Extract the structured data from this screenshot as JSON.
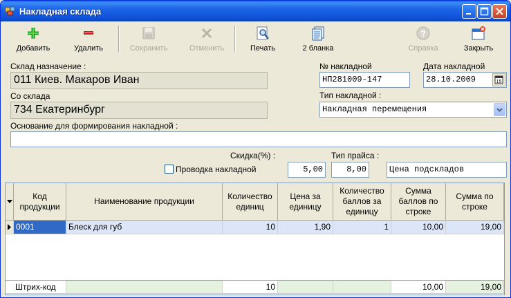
{
  "window": {
    "title": "Накладная склада"
  },
  "toolbar": {
    "add": "Добавить",
    "delete": "Удалить",
    "save": "Сохранить",
    "cancel": "Отменить",
    "print": "Печать",
    "two_forms": "2 бланка",
    "help": "Справка",
    "close": "Закрыть"
  },
  "form": {
    "dest_warehouse_label": "Склад назначение :",
    "dest_warehouse_value": "011 Киев. Макаров Иван",
    "from_warehouse_label": "Со склада",
    "from_warehouse_value": "734 Екатеринбург",
    "invoice_no_label": "№ накладной",
    "invoice_no_value": "НП281009-147",
    "invoice_date_label": "Дата накладной",
    "invoice_date_value": "28.10.2009",
    "invoice_type_label": "Тип накладной :",
    "invoice_type_value": "Накладная перемещения",
    "basis_label": "Основание для формирования накладной :",
    "basis_value": "",
    "discount_label": "Скидка(%) :",
    "discount_value": "5,00",
    "price_type_label": "Тип прайса :",
    "price_type_value": "8,00",
    "price_type_name": "Цена подскладов",
    "posting_label": "Проводка накладной",
    "posting_checked": false
  },
  "grid": {
    "columns": [
      "Код продукции",
      "Наименование продукции",
      "Количество единиц",
      "Цена за единицу",
      "Количество баллов за единицу",
      "Сумма баллов по строке",
      "Сумма по строке"
    ],
    "rows": [
      {
        "code": "0001",
        "name": "Блеск для губ",
        "qty": "10",
        "price": "1,90",
        "points": "1",
        "points_sum": "10,00",
        "sum": "19,00"
      }
    ],
    "footer": {
      "label": "Штрих-код",
      "qty": "10",
      "points_sum": "10,00",
      "sum": "19,00"
    }
  }
}
